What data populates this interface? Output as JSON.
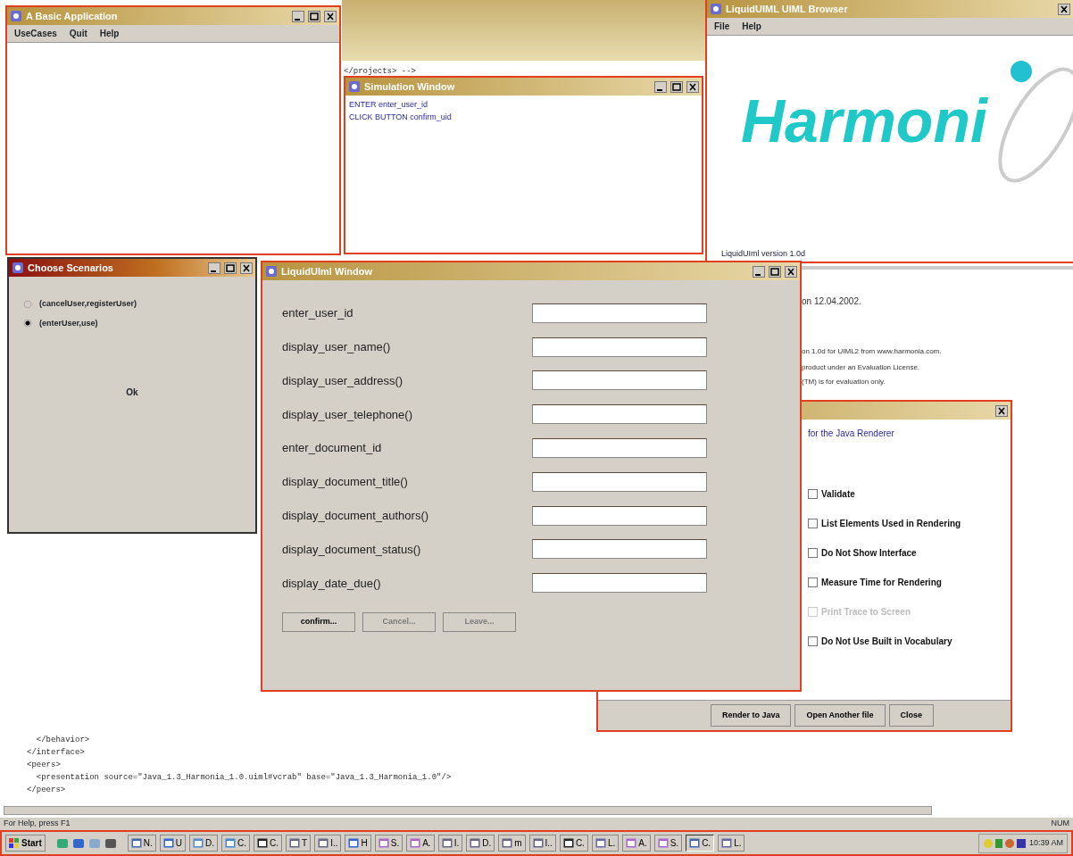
{
  "editor": {
    "top_line": "</projects> -->",
    "code_lines": [
      "  </behavior>",
      "</interface>",
      "<peers>",
      "  <presentation source=\"Java_1.3_Harmonia_1.0.uiml#vcrab\" base=\"Java_1.3_Harmonia_1.0\"/>",
      "</peers>"
    ],
    "status": "For Help, press F1",
    "indicator": "NUM"
  },
  "basic_app": {
    "title": "A Basic Application",
    "menu": [
      "UseCases",
      "Quit",
      "Help"
    ]
  },
  "simulation": {
    "title": "Simulation Window",
    "lines": [
      "ENTER enter_user_id",
      "CLICK BUTTON confirm_uid"
    ]
  },
  "browser": {
    "title": "LiquidUIML UIML Browser",
    "menu": [
      "File",
      "Help"
    ],
    "logo": "Harmoni",
    "version_link": "LiquidUIml version 1.0d",
    "info_lines": [
      "on 12.04.2002.",
      "on 1.0d for UIML2 from www.harmonia.com.",
      "product under an Evaluation License.",
      "(TM) is for evaluation only."
    ]
  },
  "scenarios": {
    "title": "Choose Scenarios",
    "options": [
      {
        "label": "(cancelUser,registerUser)",
        "selected": false
      },
      {
        "label": "(enterUser,use)",
        "selected": true
      }
    ],
    "ok": "Ok"
  },
  "form": {
    "title": "LiquidUIml Window",
    "fields": [
      "enter_user_id",
      "display_user_name()",
      "display_user_address()",
      "display_user_telephone()",
      "enter_document_id",
      "display_document_title()",
      "display_document_authors()",
      "display_document_status()",
      "display_date_due()"
    ],
    "buttons": [
      {
        "label": "confirm...",
        "disabled": false
      },
      {
        "label": "Cancel...",
        "disabled": true
      },
      {
        "label": "Leave...",
        "disabled": true
      }
    ]
  },
  "render_dialog": {
    "heading": "for the Java Renderer",
    "options": [
      {
        "label": "Validate",
        "checked": false,
        "disabled": false
      },
      {
        "label": "List Elements Used in Rendering",
        "checked": false,
        "disabled": false
      },
      {
        "label": "Do Not Show Interface",
        "checked": false,
        "disabled": false
      },
      {
        "label": "Measure Time for Rendering",
        "checked": false,
        "disabled": false
      },
      {
        "label": "Print Trace to Screen",
        "checked": false,
        "disabled": true
      },
      {
        "label": "Do Not Use Built in Vocabulary",
        "checked": false,
        "disabled": false
      }
    ],
    "buttons": [
      "Render to Java",
      "Open Another file",
      "Close"
    ]
  },
  "taskbar": {
    "start": "Start",
    "tasks": [
      "N.",
      "U",
      "D.",
      "C.",
      "C.",
      "T",
      "I..",
      "H",
      "S.",
      "A.",
      "I.",
      "D.",
      "m",
      "I..",
      "C.",
      "L.",
      "A.",
      "S.",
      "C.",
      "L."
    ],
    "clock": "10:39 AM"
  }
}
